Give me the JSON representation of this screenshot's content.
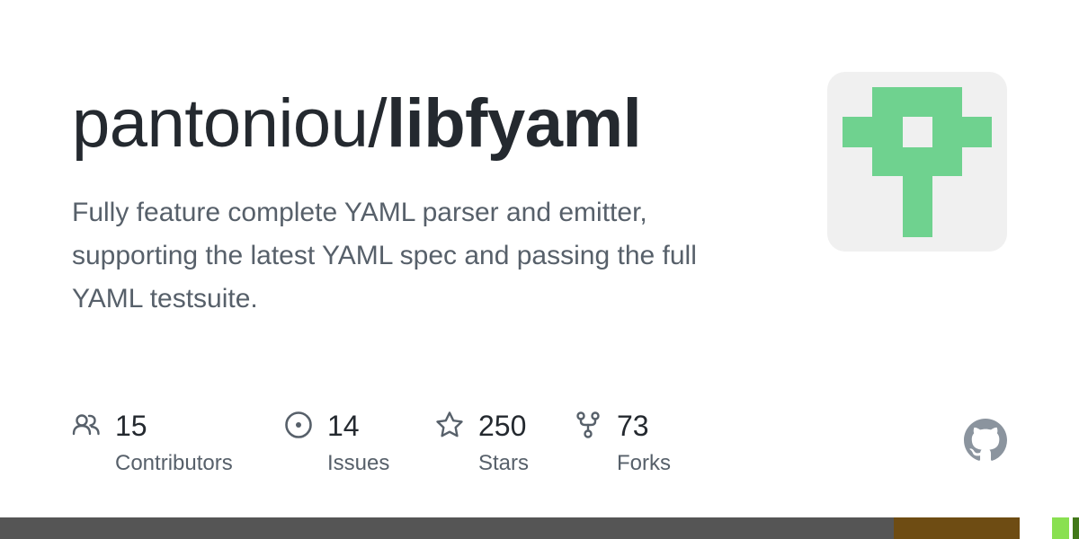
{
  "repo": {
    "owner": "pantoniou/",
    "name": "libfyaml",
    "description": "Fully feature complete YAML parser and emitter, supporting the latest YAML spec and passing the full YAML testsuite."
  },
  "avatar": {
    "background": "#f0f0f0",
    "color": "#6fd28f"
  },
  "stats": {
    "contributors": {
      "value": "15",
      "label": "Contributors",
      "icon": "people-icon"
    },
    "issues": {
      "value": "14",
      "label": "Issues",
      "icon": "issue-opened-icon"
    },
    "stars": {
      "value": "250",
      "label": "Stars",
      "icon": "star-icon"
    },
    "forks": {
      "value": "73",
      "label": "Forks",
      "icon": "repo-forked-icon"
    }
  },
  "colors": {
    "text_primary": "#24292f",
    "text_secondary": "#57606a",
    "icon": "#57606a",
    "github_mark": "#8b949e"
  },
  "language_bar": [
    {
      "color": "#555555",
      "share": 0.828
    },
    {
      "color": "#6e4c13",
      "share": 0.117
    },
    {
      "color": "#ffffff",
      "share": 0.03
    },
    {
      "color": "#89e051",
      "share": 0.016
    },
    {
      "color": "#ffffff",
      "share": 0.003
    },
    {
      "color": "#427819",
      "share": 0.006
    }
  ]
}
